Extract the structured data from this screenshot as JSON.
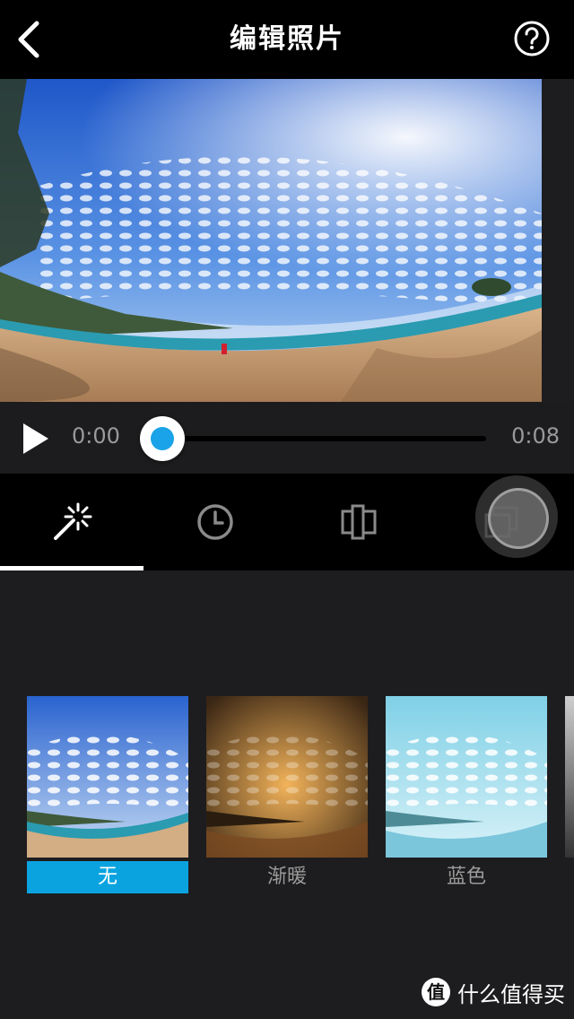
{
  "header": {
    "title": "编辑照片",
    "back_icon": "chevron-left-icon",
    "help_icon": "question-circle-icon"
  },
  "player": {
    "current_time": "0:00",
    "total_time": "0:08",
    "progress": 0
  },
  "tabs": [
    {
      "name": "magic-wand",
      "icon": "magic-wand-icon",
      "selected": true
    },
    {
      "name": "clock",
      "icon": "clock-icon",
      "selected": false
    },
    {
      "name": "crop",
      "icon": "crop-icon",
      "selected": false
    },
    {
      "name": "frames",
      "icon": "frames-icon",
      "selected": false
    }
  ],
  "filters": [
    {
      "label": "无",
      "selected": true
    },
    {
      "label": "渐暖",
      "selected": false
    },
    {
      "label": "蓝色",
      "selected": false
    }
  ],
  "watermark": {
    "badge": "值",
    "text": "什么值得买"
  },
  "colors": {
    "accent": "#0aa3e0",
    "background": "#1d1d1f",
    "bar": "#000000"
  }
}
